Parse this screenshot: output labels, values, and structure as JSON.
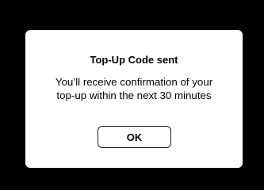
{
  "dialog": {
    "title": "Top-Up Code sent",
    "message": "You’ll receive confirmation of your\ntop-up within the next 30 minutes",
    "ok_label": "OK"
  },
  "colors": {
    "background": "#000000",
    "dialog_background": "#ffffff",
    "text": "#000000"
  }
}
